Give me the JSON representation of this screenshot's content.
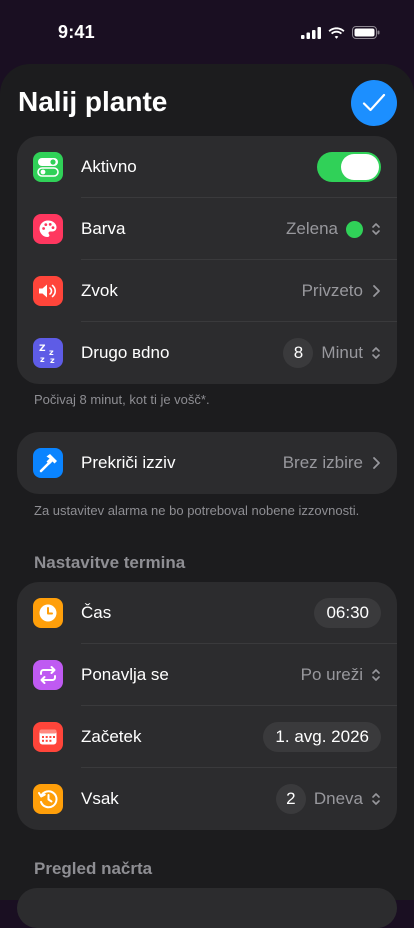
{
  "status": {
    "time": "9:41"
  },
  "header": {
    "title": "Nalij plante"
  },
  "general": [
    {
      "label": "Aktivno",
      "toggle_on": true,
      "icon": "toggle-icon",
      "color": "#30d158"
    },
    {
      "label": "Barva",
      "value": "Zelena",
      "icon": "palette-icon",
      "color": "#ff375f",
      "dot_color": "#30d158"
    },
    {
      "label": "Zvok",
      "value": "Privzeto",
      "icon": "speaker-icon",
      "color": "#ff453a"
    },
    {
      "label": "Drugo вdno",
      "number": "8",
      "value": "Minut",
      "icon": "zzz-icon",
      "color": "#5e5ce6"
    }
  ],
  "general_footer": "Počivaj 8 minut, kot ti je vošč*.",
  "challenge": {
    "label": "Prekriči izziv",
    "value": "Brez izbire",
    "icon": "hammer-icon",
    "color": "#0a84ff"
  },
  "challenge_footer": "Za ustavitev alarma ne bo potreboval nobene izzovnosti.",
  "schedule_title": "Nastavitve termina",
  "schedule": [
    {
      "label": "Čas",
      "value": "06:30",
      "icon": "clock-icon",
      "color": "#ff9f0a"
    },
    {
      "label": "Ponavlja se",
      "value": "Po ureži",
      "icon": "repeat-icon",
      "color": "#bf5af2"
    },
    {
      "label": "Začetek",
      "value": "1. avg. 2026",
      "icon": "calendar-icon",
      "color": "#ff453a"
    },
    {
      "label": "Vsak",
      "number": "2",
      "value": "Dneva",
      "icon": "history-icon",
      "color": "#ff9f0a"
    }
  ],
  "preview_title": "Pregled načrta"
}
